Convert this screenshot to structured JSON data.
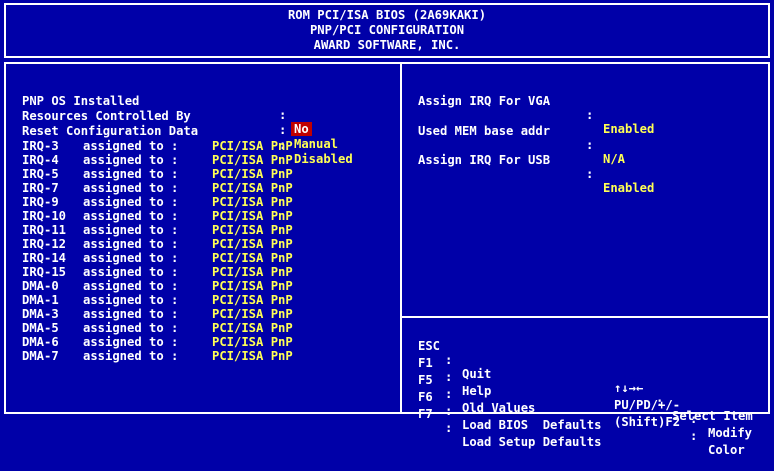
{
  "header": {
    "line1": "ROM PCI/ISA BIOS (2A69KAKI)",
    "line2": "PNP/PCI CONFIGURATION",
    "line3": "AWARD SOFTWARE, INC."
  },
  "left": {
    "pnp_os": {
      "label": "PNP OS Installed",
      "sep": ":",
      "value": "No"
    },
    "resources": {
      "label": "Resources Controlled By",
      "sep": ":",
      "value": "Manual"
    },
    "reset": {
      "label": "Reset Configuration Data",
      "sep": ":",
      "value": "Disabled"
    },
    "assignments": [
      {
        "label": "IRQ-3",
        "text": "assigned to :",
        "value": "PCI/ISA PnP"
      },
      {
        "label": "IRQ-4",
        "text": "assigned to :",
        "value": "PCI/ISA PnP"
      },
      {
        "label": "IRQ-5",
        "text": "assigned to :",
        "value": "PCI/ISA PnP"
      },
      {
        "label": "IRQ-7",
        "text": "assigned to :",
        "value": "PCI/ISA PnP"
      },
      {
        "label": "IRQ-9",
        "text": "assigned to :",
        "value": "PCI/ISA PnP"
      },
      {
        "label": "IRQ-10",
        "text": "assigned to :",
        "value": "PCI/ISA PnP"
      },
      {
        "label": "IRQ-11",
        "text": "assigned to :",
        "value": "PCI/ISA PnP"
      },
      {
        "label": "IRQ-12",
        "text": "assigned to :",
        "value": "PCI/ISA PnP"
      },
      {
        "label": "IRQ-14",
        "text": "assigned to :",
        "value": "PCI/ISA PnP"
      },
      {
        "label": "IRQ-15",
        "text": "assigned to :",
        "value": "PCI/ISA PnP"
      },
      {
        "label": "DMA-0",
        "text": "assigned to :",
        "value": "PCI/ISA PnP"
      },
      {
        "label": "DMA-1",
        "text": "assigned to :",
        "value": "PCI/ISA PnP"
      },
      {
        "label": "DMA-3",
        "text": "assigned to :",
        "value": "PCI/ISA PnP"
      },
      {
        "label": "DMA-5",
        "text": "assigned to :",
        "value": "PCI/ISA PnP"
      },
      {
        "label": "DMA-6",
        "text": "assigned to :",
        "value": "PCI/ISA PnP"
      },
      {
        "label": "DMA-7",
        "text": "assigned to :",
        "value": "PCI/ISA PnP"
      }
    ]
  },
  "right": {
    "vga": {
      "label": "Assign IRQ For VGA",
      "sep": ":",
      "value": "Enabled"
    },
    "mem": {
      "label": "Used MEM base addr",
      "sep": ":",
      "value": "N/A"
    },
    "usb": {
      "label": "Assign IRQ For USB",
      "sep": ":",
      "value": "Enabled"
    }
  },
  "help": {
    "r1": {
      "k1": "ESC",
      "s1": ":",
      "t1": "Quit",
      "k2": "↑↓→←",
      "s2": ":",
      "t2": "Select Item"
    },
    "r2": {
      "k1": "F1",
      "s1": ":",
      "t1": "Help",
      "k2": "PU/PD/+/-",
      "s2": ":",
      "t2": "Modify"
    },
    "r3": {
      "k1": "F5",
      "s1": ":",
      "t1": "Old Values",
      "k2": "(Shift)F2",
      "s2": ":",
      "t2": "Color"
    },
    "r4": {
      "k1": "F6",
      "s1": ":",
      "t1": "Load BIOS  Defaults"
    },
    "r5": {
      "k1": "F7",
      "s1": ":",
      "t1": "Load Setup Defaults"
    }
  },
  "colors": {
    "background": "#0000a8",
    "value": "#ffff54",
    "label": "#ffffff",
    "selection": "#c00000"
  }
}
